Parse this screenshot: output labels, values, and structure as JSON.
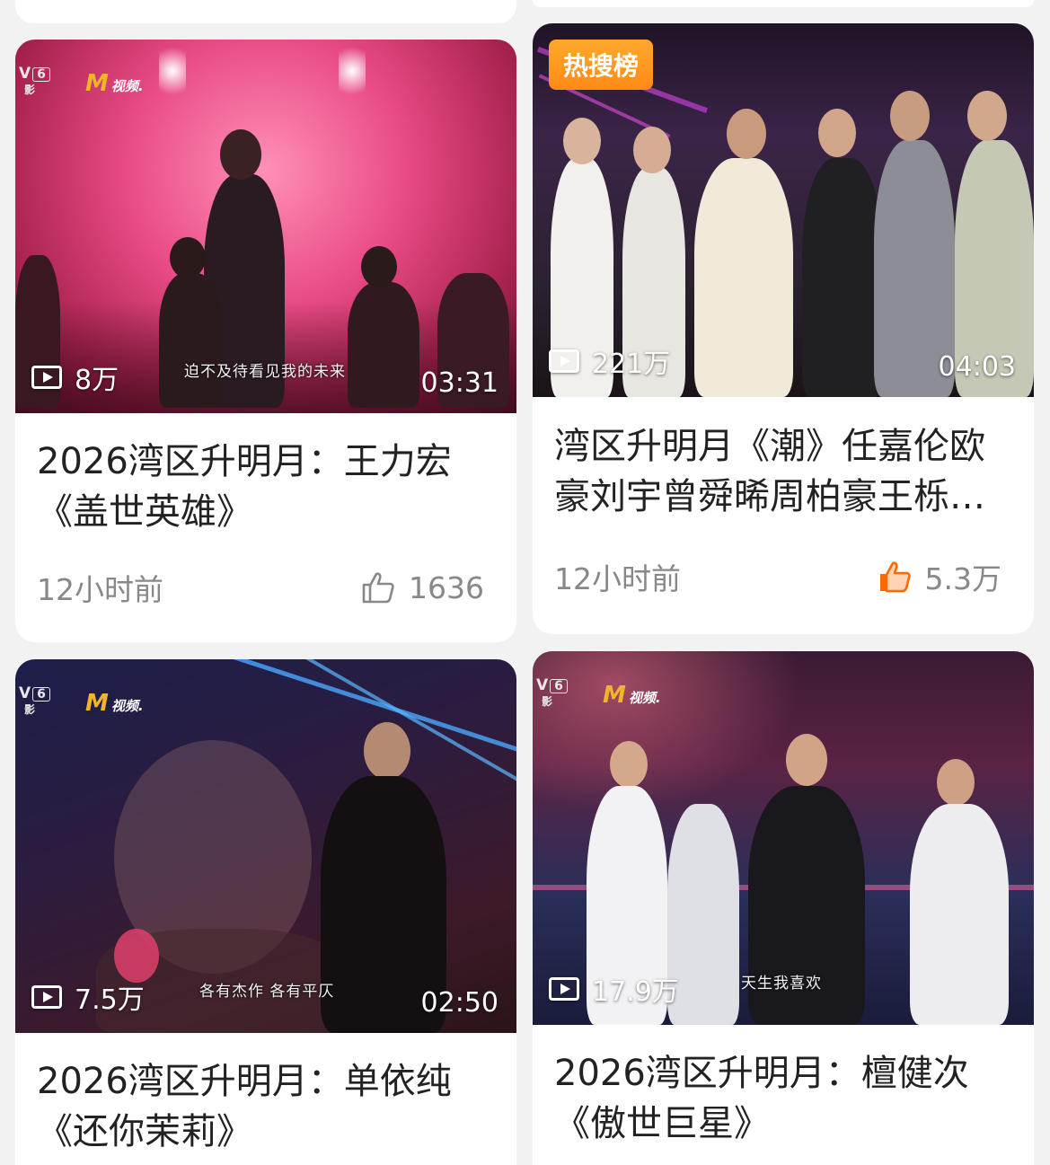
{
  "cards": [
    {
      "title": "2026湾区升明月：王力宏《盖世英雄》",
      "title_line1": "2026湾区升明月：王力宏",
      "title_line2": "《盖世英雄》",
      "views": "8万",
      "duration": "03:31",
      "subtitle": "迫不及待看见我的未来",
      "time_ago": "12小时前",
      "likes": "1636",
      "liked": false,
      "channel_logo": "CCTV-6",
      "brand_logo": "M视频"
    },
    {
      "badge": "热搜榜",
      "title_line1": "湾区升明月《潮》任嘉伦欧",
      "title_line2": "豪刘宇曾舜晞周柏豪王栎…",
      "views": "221万",
      "duration": "04:03",
      "time_ago": "12小时前",
      "likes": "5.3万",
      "liked": true
    },
    {
      "title_line1": "2026湾区升明月：单依纯",
      "title_line2": "《还你茉莉》",
      "views": "7.5万",
      "duration": "02:50",
      "subtitle": "各有杰作 各有平仄",
      "channel_logo": "CCTV-6",
      "brand_logo": "M视频"
    },
    {
      "title_line1": "2026湾区升明月：檀健次",
      "title_line2": "《傲世巨星》",
      "views": "17.9万",
      "subtitle": "天生我喜欢",
      "channel_logo": "CCTV-6",
      "brand_logo": "M视频"
    }
  ],
  "colors": {
    "accent_orange": "#ff8a16",
    "liked_icon": "#ff6a00",
    "text_dark": "#222222",
    "text_gray": "#888888"
  },
  "icons": {
    "play": "play-count-icon",
    "like": "thumbs-up-icon"
  }
}
